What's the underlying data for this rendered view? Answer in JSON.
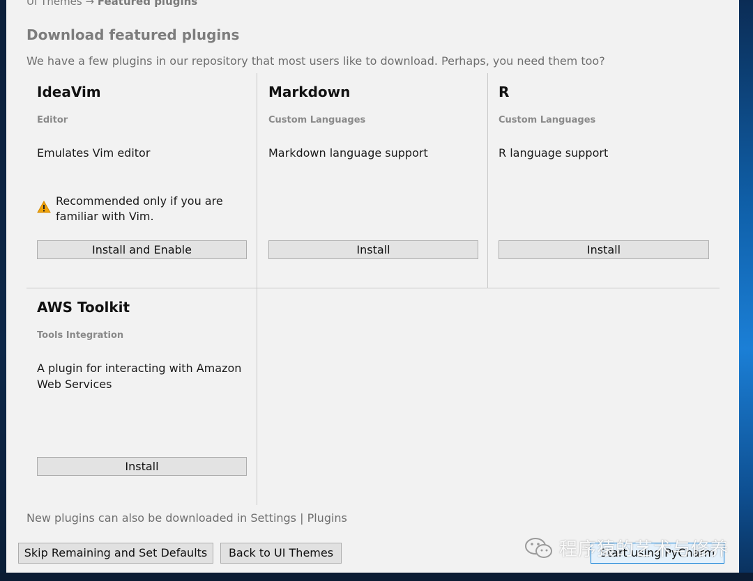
{
  "breadcrumb": {
    "previous": "UI Themes",
    "arrow": "→",
    "current": "Featured plugins"
  },
  "header": {
    "title": "Download featured plugins",
    "subtitle": "We have a few plugins in our repository that most users like to download. Perhaps, you need them too?"
  },
  "plugins": [
    {
      "name": "IdeaVim",
      "category": "Editor",
      "description": "Emulates Vim editor",
      "warning": "Recommended only if you are familiar with Vim.",
      "button": "Install and Enable"
    },
    {
      "name": "Markdown",
      "category": "Custom Languages",
      "description": "Markdown language support",
      "button": "Install"
    },
    {
      "name": "R",
      "category": "Custom Languages",
      "description": "R language support",
      "button": "Install"
    },
    {
      "name": "AWS Toolkit",
      "category": "Tools Integration",
      "description": "A plugin for interacting with Amazon Web Services",
      "button": "Install"
    }
  ],
  "footer": {
    "note": "New plugins can also be downloaded in Settings | Plugins",
    "skip_button": "Skip Remaining and Set Defaults",
    "back_button": "Back to UI Themes",
    "start_button": "Start using PyCharm"
  },
  "watermark": {
    "text": "程序猿的艺术与修养",
    "icon": "wechat-icon"
  },
  "colors": {
    "window_bg": "#f2f2f2",
    "warning": "#f0a30a",
    "default_button_border": "#0078d7"
  }
}
